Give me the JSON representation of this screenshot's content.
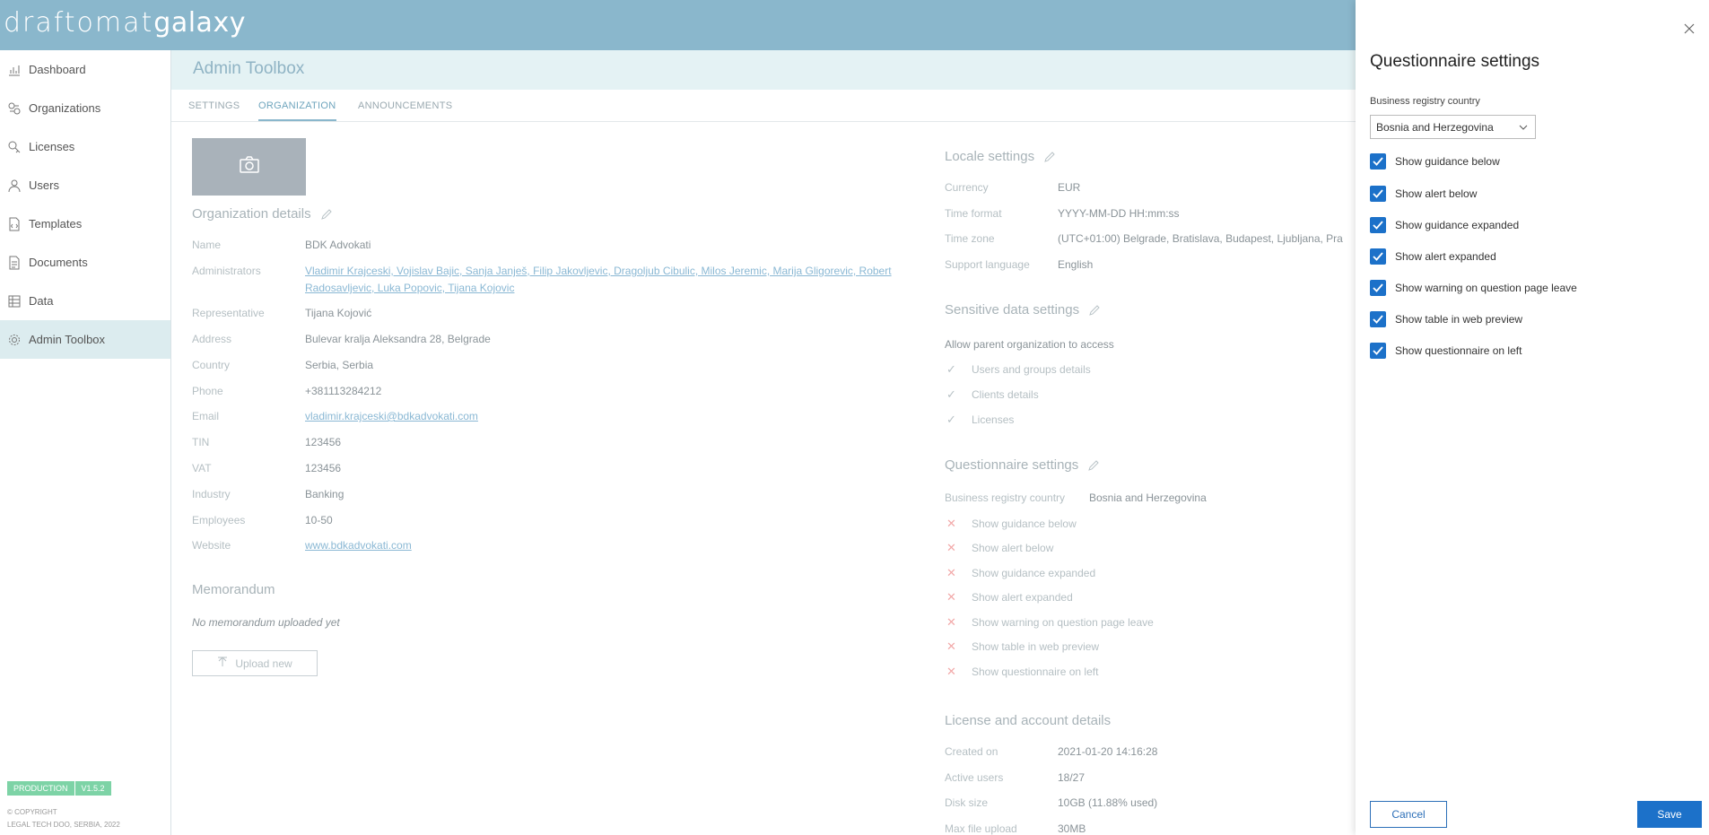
{
  "app": {
    "logo_left": "draftomat",
    "logo_right": "galaxy"
  },
  "sidebar": {
    "items": [
      {
        "label": "Dashboard",
        "icon": "chart-icon"
      },
      {
        "label": "Organizations",
        "icon": "organizations-icon"
      },
      {
        "label": "Licenses",
        "icon": "key-icon"
      },
      {
        "label": "Users",
        "icon": "user-icon"
      },
      {
        "label": "Templates",
        "icon": "template-icon"
      },
      {
        "label": "Documents",
        "icon": "document-icon"
      },
      {
        "label": "Data",
        "icon": "data-icon"
      },
      {
        "label": "Admin Toolbox",
        "icon": "gear-icon"
      }
    ],
    "env_badge": "PRODUCTION",
    "version_badge": "V1.5.2",
    "copyright_line1": "© COPYRIGHT",
    "copyright_line2": "LEGAL TECH DOO, SERBIA, 2022"
  },
  "header": {
    "title": "Admin Toolbox",
    "tabs": [
      "SETTINGS",
      "ORGANIZATION",
      "ANNOUNCEMENTS"
    ]
  },
  "org": {
    "details_title": "Organization details",
    "labels": {
      "name": "Name",
      "admins": "Administrators",
      "representative": "Representative",
      "address": "Address",
      "country": "Country",
      "phone": "Phone",
      "email": "Email",
      "tin": "TIN",
      "vat": "VAT",
      "industry": "Industry",
      "employees": "Employees",
      "website": "Website"
    },
    "values": {
      "name": "BDK Advokati",
      "admins": "Vladimir Krajceski, Vojislav Bajic, Sanja Janješ, Filip Jakovljevic, Dragoljub Cibulic, Milos Jeremic, Marija Gligorevic, Robert Radosavljevic, Luka Popovic, Tijana Kojovic",
      "representative": "Tijana Kojović",
      "address": "Bulevar kralja Aleksandra 28, Belgrade",
      "country": "Serbia, Serbia",
      "phone": "+381113284212",
      "email": "vladimir.krajceski@bdkadvokati.com",
      "tin": "123456",
      "vat": "123456",
      "industry": "Banking",
      "employees": "10-50",
      "website": "www.bdkadvokati.com"
    },
    "memorandum_title": "Memorandum",
    "memorandum_empty": "No memorandum uploaded yet",
    "upload_label": "Upload new"
  },
  "locale": {
    "title": "Locale settings",
    "labels": {
      "currency": "Currency",
      "time_format": "Time format",
      "time_zone": "Time zone",
      "support_language": "Support language"
    },
    "values": {
      "currency": "EUR",
      "time_format": "YYYY-MM-DD HH:mm:ss",
      "time_zone": "(UTC+01:00) Belgrade, Bratislava, Budapest, Ljubljana, Pra",
      "support_language": "English"
    }
  },
  "sensitive": {
    "title": "Sensitive data settings",
    "intro": "Allow parent organization to access",
    "items": [
      "Users and groups details",
      "Clients details",
      "Licenses"
    ]
  },
  "questionnaire_summary": {
    "title": "Questionnaire settings",
    "country_label": "Business registry country",
    "country_value": "Bosnia and Herzegovina",
    "items": [
      "Show guidance below",
      "Show alert below",
      "Show guidance expanded",
      "Show alert expanded",
      "Show warning on question page leave",
      "Show table in web preview",
      "Show questionnaire on left"
    ]
  },
  "license": {
    "title": "License and account details",
    "labels": {
      "created_on": "Created on",
      "active_users": "Active users",
      "disk_size": "Disk size",
      "max_file_upload": "Max file upload"
    },
    "values": {
      "created_on": "2021-01-20 14:16:28",
      "active_users": "18/27",
      "disk_size": "10GB (11.88% used)",
      "max_file_upload": "30MB"
    }
  },
  "drawer": {
    "title": "Questionnaire settings",
    "country_label": "Business registry country",
    "country_value": "Bosnia and Herzegovina",
    "options": [
      {
        "label": "Show guidance below",
        "checked": true
      },
      {
        "label": "Show alert below",
        "checked": true
      },
      {
        "label": "Show guidance expanded",
        "checked": true
      },
      {
        "label": "Show alert expanded",
        "checked": true
      },
      {
        "label": "Show warning on question page leave",
        "checked": true
      },
      {
        "label": "Show table in web preview",
        "checked": true
      },
      {
        "label": "Show questionnaire on left",
        "checked": true
      }
    ],
    "cancel_label": "Cancel",
    "save_label": "Save"
  },
  "colors": {
    "topbar": "#8ab7cc",
    "accent_blue": "#1c71c9",
    "active_nav": "#dcecef",
    "badge_green": "#7dd3a6"
  }
}
